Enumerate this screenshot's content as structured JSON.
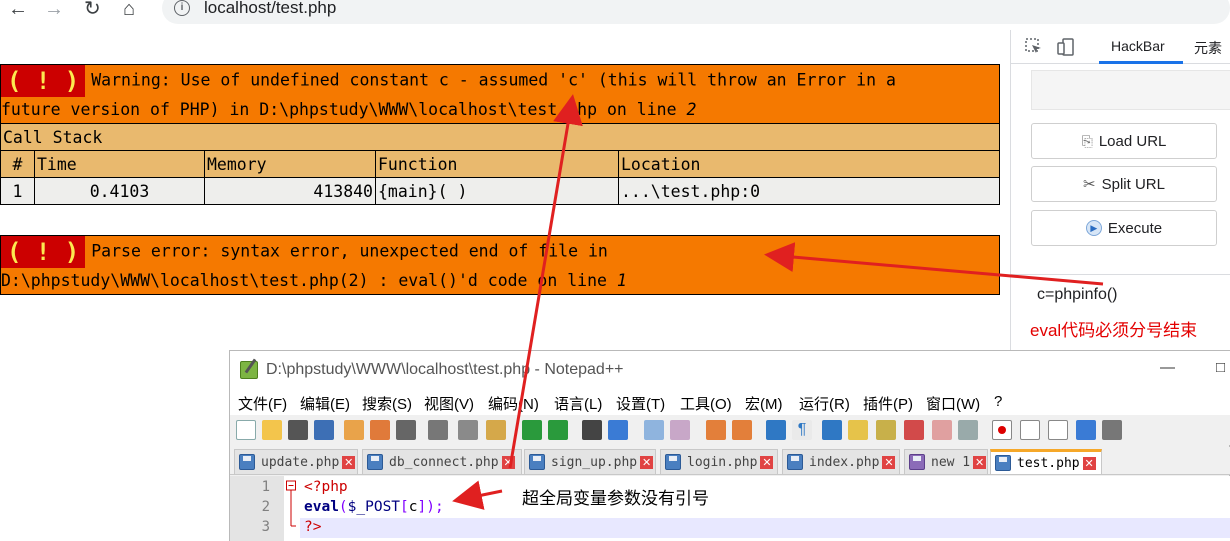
{
  "browser": {
    "url": "localhost/test.php",
    "nav_icons": [
      "back-arrow-icon",
      "forward-arrow-icon",
      "reload-icon",
      "home-icon",
      "info-icon"
    ]
  },
  "warning": {
    "bang": "( ! )",
    "message_line1": "Warning: Use of undefined constant c - assumed 'c' (this will throw an Error in a",
    "message_line2_pre": "future version of PHP) in D:\\phpstudy\\WWW\\localhost\\test.php on line ",
    "message_line_no": "2",
    "call_stack_label": "Call Stack",
    "columns": [
      "#",
      "Time",
      "Memory",
      "Function",
      "Location"
    ],
    "rows": [
      {
        "num": "1",
        "time": "0.4103",
        "memory": "413840",
        "function": "{main}( )",
        "location": "...\\test.php:0"
      }
    ]
  },
  "parse_error": {
    "bang": "( ! )",
    "message_line1": "Parse error: syntax error, unexpected end of file in",
    "message_line2_pre": "D:\\phpstudy\\WWW\\localhost\\test.php(2) : eval()'d code on line ",
    "message_line_no": "1"
  },
  "devtools": {
    "tabs": [
      "HackBar",
      "元素"
    ],
    "active_tab": "HackBar",
    "buttons": {
      "load_url": "Load URL",
      "split_url": "Split URL",
      "execute": "Execute"
    },
    "post_data": "c=phpinfo()"
  },
  "annotations": {
    "eval_note": "eval代码必须分号结束",
    "superglobal_note": "超全局变量参数没有引号",
    "color": "#e30000"
  },
  "notepad": {
    "title": "D:\\phpstudy\\WWW\\localhost\\test.php - Notepad++",
    "menu": [
      "文件(F)",
      "编辑(E)",
      "搜索(S)",
      "视图(V)",
      "编码(N)",
      "语言(L)",
      "设置(T)",
      "工具(O)",
      "宏(M)",
      "运行(R)",
      "插件(P)",
      "窗口(W)",
      "?"
    ],
    "tabs": [
      {
        "label": "update.php"
      },
      {
        "label": "db_connect.php"
      },
      {
        "label": "sign_up.php"
      },
      {
        "label": "login.php"
      },
      {
        "label": "index.php"
      },
      {
        "label": "new 1"
      },
      {
        "label": "test.php"
      }
    ],
    "active_tab": "test.php",
    "code": {
      "line1_no": "1",
      "line2_no": "2",
      "line3_no": "3",
      "open_tag": "<?php",
      "eval_kw": "eval",
      "paren_open": "(",
      "var": "$_POST",
      "bracket_open": "[",
      "key": "c",
      "close_seq": "]);",
      "close_tag": "?>"
    }
  }
}
